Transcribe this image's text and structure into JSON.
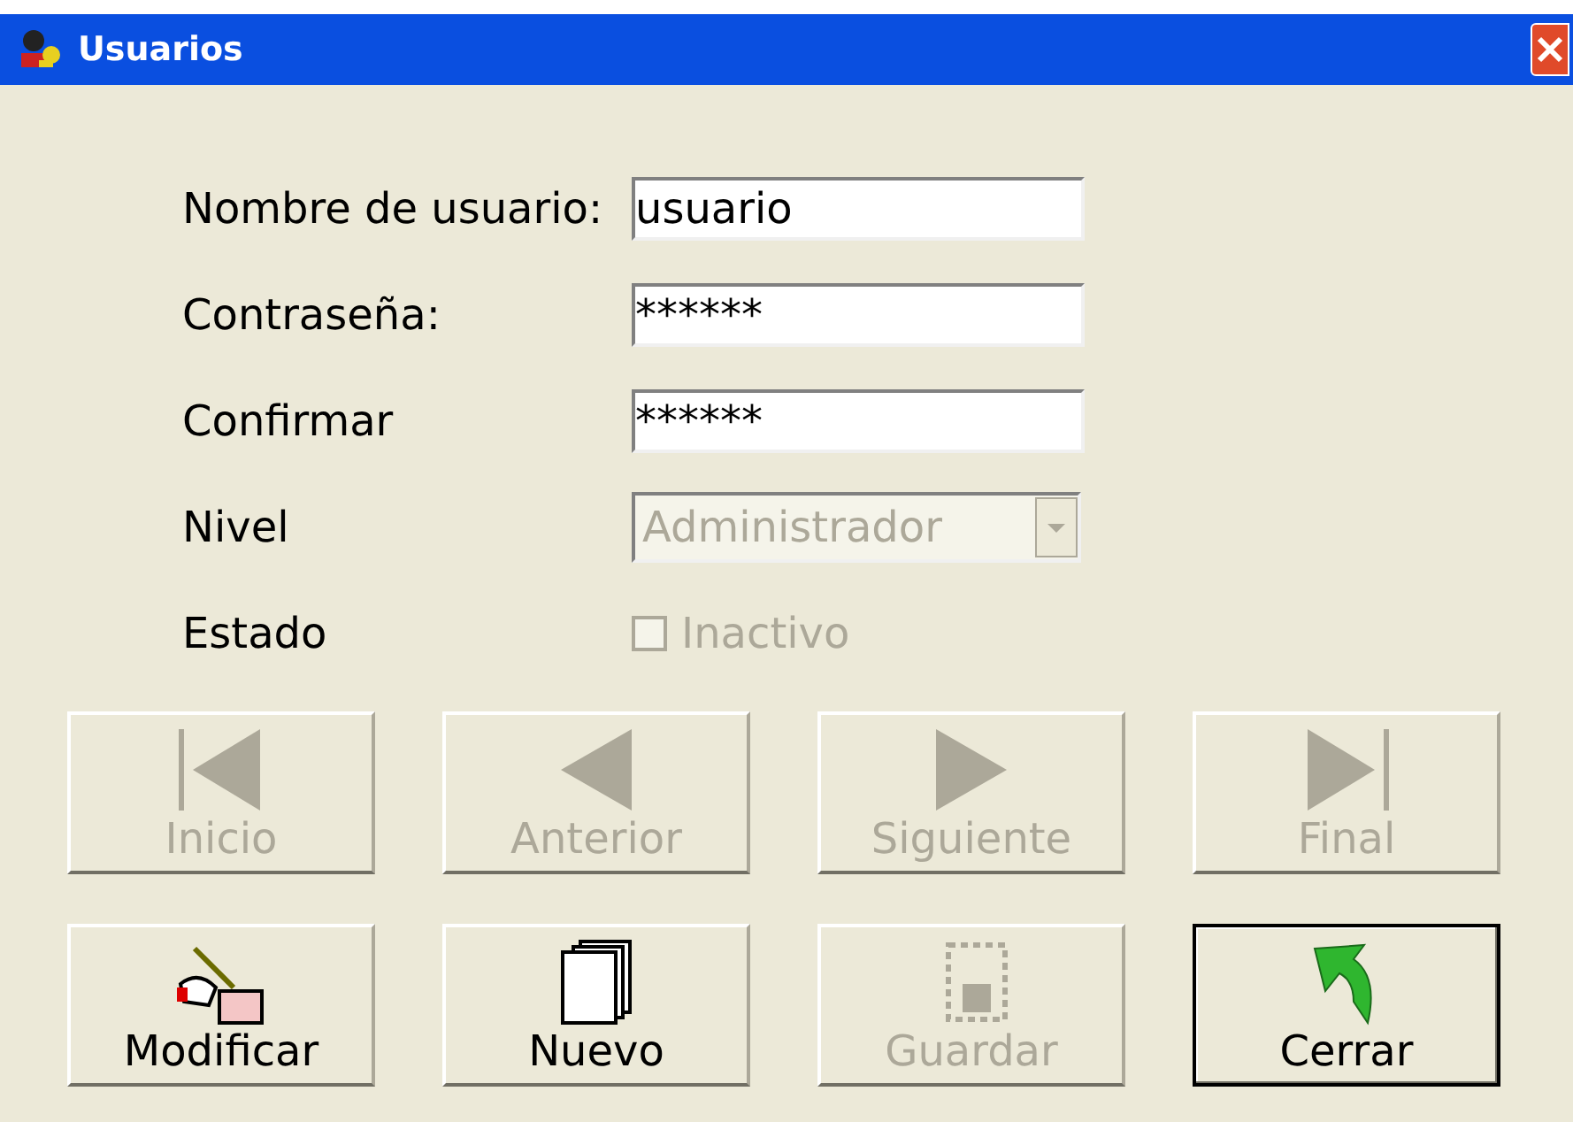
{
  "window": {
    "title": "Usuarios"
  },
  "fields": [
    {
      "kind": "text",
      "label": "Nombre de usuario:",
      "value": "usuario"
    },
    {
      "kind": "text",
      "label": "Contraseña:",
      "value": "******"
    },
    {
      "kind": "text",
      "label": "Confirmar",
      "value": "******"
    },
    {
      "kind": "select",
      "label": "Nivel",
      "value": "Administrador",
      "disabled": true
    },
    {
      "kind": "checkbox",
      "label": "Estado",
      "value": "Inactivo",
      "checked": false,
      "disabled": true
    }
  ],
  "nav_buttons": [
    {
      "kind": "first",
      "label": "Inicio",
      "disabled": true
    },
    {
      "kind": "prev",
      "label": "Anterior",
      "disabled": true
    },
    {
      "kind": "next",
      "label": "Siguiente",
      "disabled": true
    },
    {
      "kind": "last",
      "label": "Final",
      "disabled": true
    }
  ],
  "action_buttons": [
    {
      "kind": "edit",
      "label": "Modificar",
      "disabled": false,
      "focused": false
    },
    {
      "kind": "new",
      "label": "Nuevo",
      "disabled": false,
      "focused": false
    },
    {
      "kind": "save",
      "label": "Guardar",
      "disabled": true,
      "focused": false
    },
    {
      "kind": "close",
      "label": "Cerrar",
      "disabled": false,
      "focused": true
    }
  ]
}
